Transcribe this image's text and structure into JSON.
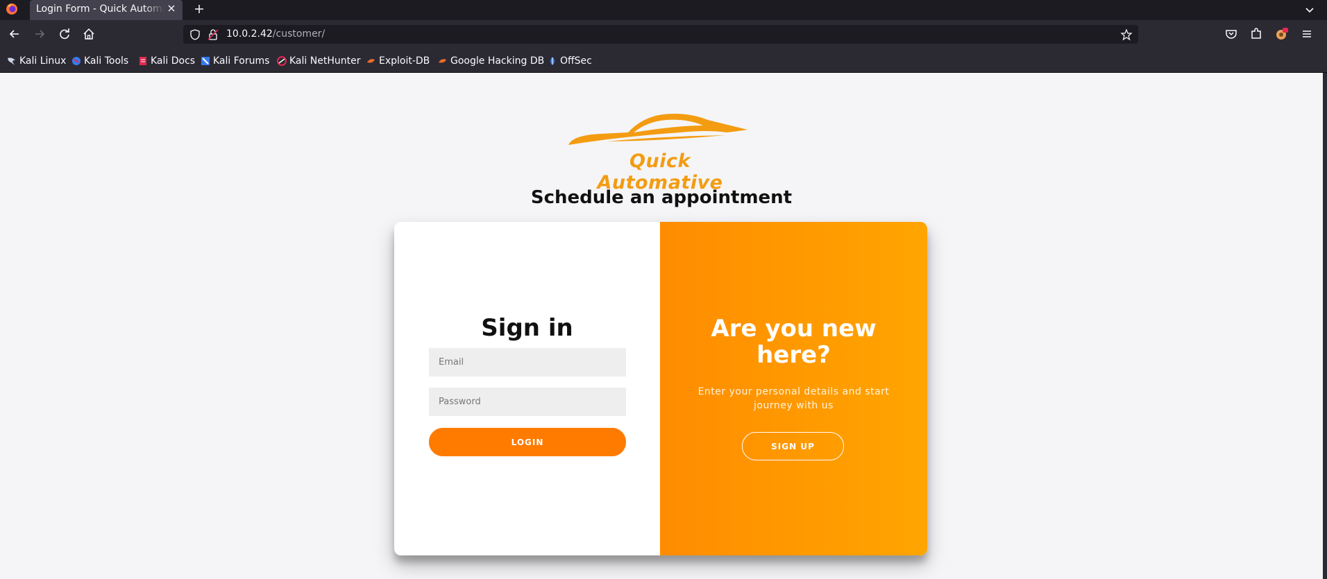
{
  "browser": {
    "tab_title": "Login Form - Quick Automative",
    "url_host": "10.0.2.42",
    "url_path": "/customer/",
    "bookmarks": [
      {
        "label": "Kali Linux",
        "icon": "kali-dragon-icon"
      },
      {
        "label": "Kali Tools",
        "icon": "kali-tools-icon"
      },
      {
        "label": "Kali Docs",
        "icon": "kali-docs-icon"
      },
      {
        "label": "Kali Forums",
        "icon": "kali-forums-icon"
      },
      {
        "label": "Kali NetHunter",
        "icon": "nethunter-icon"
      },
      {
        "label": "Exploit-DB",
        "icon": "exploit-db-icon"
      },
      {
        "label": "Google Hacking DB",
        "icon": "ghdb-icon"
      },
      {
        "label": "OffSec",
        "icon": "offsec-icon"
      }
    ]
  },
  "page": {
    "brand_name": "Quick Automative",
    "heading": "Schedule an appointment",
    "signin": {
      "title": "Sign in",
      "email_placeholder": "Email",
      "password_placeholder": "Password",
      "login_label": "LOGIN"
    },
    "signup_panel": {
      "title": "Are you new here?",
      "description": "Enter your personal details and start journey with us",
      "signup_label": "SIGN UP"
    }
  },
  "colors": {
    "accent": "#ff7b00",
    "panel_gradient_start": "#ff8c00",
    "panel_gradient_end": "#ffa500",
    "logo": "#f39c12"
  }
}
